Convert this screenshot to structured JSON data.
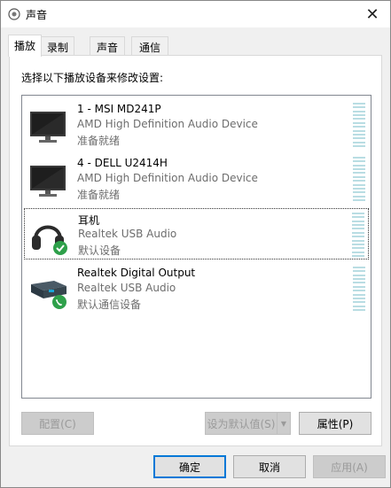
{
  "window": {
    "title": "声音",
    "icon": "speaker-icon",
    "close_glyph": "✕"
  },
  "tabs": [
    {
      "label": "播放",
      "active": true
    },
    {
      "label": "录制",
      "active": false
    },
    {
      "label": "声音",
      "active": false
    },
    {
      "label": "通信",
      "active": false
    }
  ],
  "panel": {
    "instruction": "选择以下播放设备来修改设置:"
  },
  "devices": [
    {
      "name": "1 - MSI MD241P",
      "driver": "AMD High Definition Audio Device",
      "status": "准备就绪",
      "icon": "monitor-icon"
    },
    {
      "name": "4 - DELL U2414H",
      "driver": "AMD High Definition Audio Device",
      "status": "准备就绪",
      "icon": "monitor-icon"
    },
    {
      "name": "耳机",
      "driver": "Realtek USB Audio",
      "status": "默认设备",
      "icon": "headphones-icon",
      "badge": "default-check-icon"
    },
    {
      "name": "Realtek Digital Output",
      "driver": "Realtek USB Audio",
      "status": "默认通信设备",
      "icon": "digital-output-icon",
      "badge": "phone-icon"
    }
  ],
  "buttons": {
    "configure": "配置(C)",
    "set_default": "设为默认值(S)",
    "properties": "属性(P)",
    "ok": "确定",
    "cancel": "取消",
    "apply": "应用(A)"
  },
  "colors": {
    "accent": "#0078d7",
    "badge_green": "#2ea04a",
    "meter": "#b9dde3"
  }
}
